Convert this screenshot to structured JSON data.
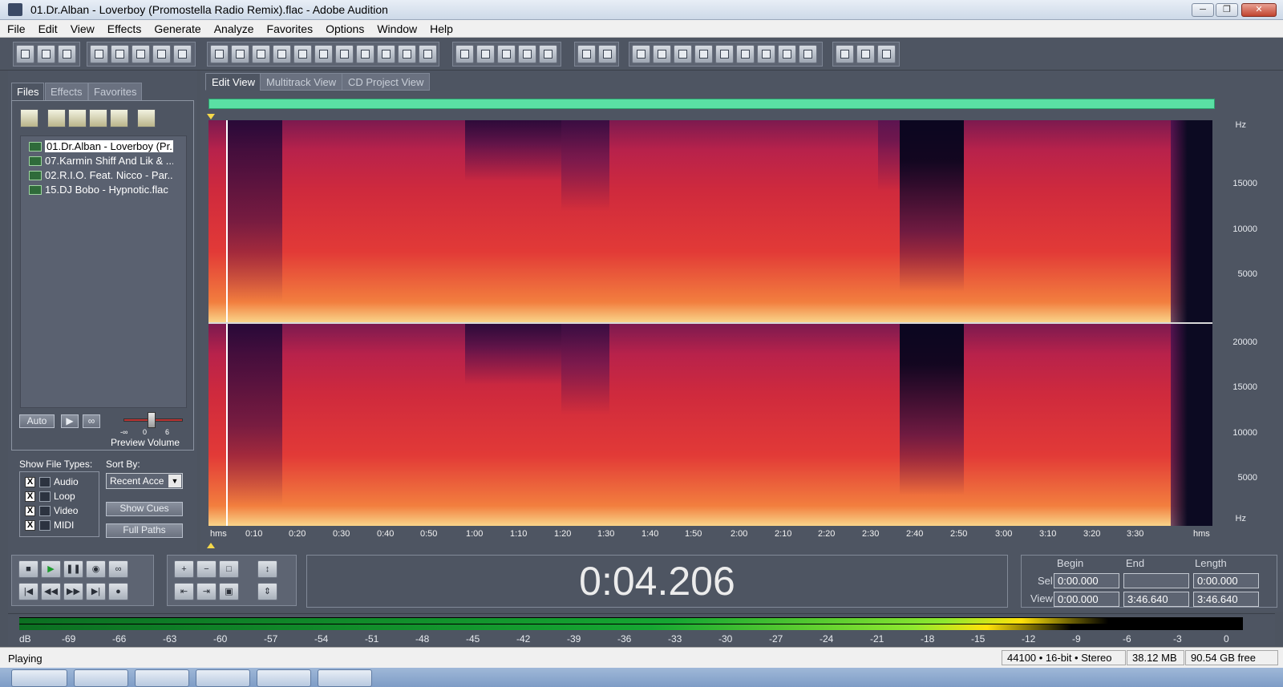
{
  "window": {
    "title": "01.Dr.Alban - Loverboy (Promostella Radio Remix).flac - Adobe Audition"
  },
  "menu": [
    "File",
    "Edit",
    "View",
    "Effects",
    "Generate",
    "Analyze",
    "Favorites",
    "Options",
    "Window",
    "Help"
  ],
  "panel": {
    "tabs": [
      "Files",
      "Effects",
      "Favorites"
    ],
    "files": [
      "01.Dr.Alban - Loverboy (Pr...",
      "07.Karmin Shiff And Lik & ...",
      "02.R.I.O. Feat. Nicco - Par...",
      "15.DJ Bobo - Hypnotic.flac"
    ],
    "auto_label": "Auto",
    "preview_volume_label": "Preview Volume",
    "slider_ticks": [
      "-∞",
      "0",
      "6"
    ],
    "show_file_types_label": "Show File Types:",
    "sort_by_label": "Sort By:",
    "file_types": [
      {
        "label": "Audio",
        "checked": "X"
      },
      {
        "label": "Loop",
        "checked": "X"
      },
      {
        "label": "Video",
        "checked": "X"
      },
      {
        "label": "MIDI",
        "checked": "X"
      }
    ],
    "sort_value": "Recent Acce",
    "show_cues_label": "Show Cues",
    "full_paths_label": "Full Paths"
  },
  "views": {
    "tabs": [
      "Edit View",
      "Multitrack View",
      "CD Project View"
    ]
  },
  "spectrogram": {
    "hz_unit": "Hz",
    "top_channel_ticks": [
      "15000",
      "10000",
      "5000"
    ],
    "bottom_channel_ticks": [
      "20000",
      "15000",
      "10000",
      "5000"
    ],
    "time_unit": "hms",
    "time_ticks": [
      "0:10",
      "0:20",
      "0:30",
      "0:40",
      "0:50",
      "1:00",
      "1:10",
      "1:20",
      "1:30",
      "1:40",
      "1:50",
      "2:00",
      "2:10",
      "2:20",
      "2:30",
      "2:40",
      "2:50",
      "3:00",
      "3:10",
      "3:20",
      "3:30"
    ]
  },
  "transport": {
    "time": "0:04.206"
  },
  "selection": {
    "headers": [
      "Begin",
      "End",
      "Length"
    ],
    "sel_label": "Sel",
    "view_label": "View",
    "sel": {
      "begin": "0:00.000",
      "end": "",
      "length": "0:00.000"
    },
    "view": {
      "begin": "0:00.000",
      "end": "3:46.640",
      "length": "3:46.640"
    }
  },
  "meter": {
    "scale": [
      "dB",
      "-69",
      "-66",
      "-63",
      "-60",
      "-57",
      "-54",
      "-51",
      "-48",
      "-45",
      "-42",
      "-39",
      "-36",
      "-33",
      "-30",
      "-27",
      "-24",
      "-21",
      "-18",
      "-15",
      "-12",
      "-9",
      "-6",
      "-3",
      "0"
    ],
    "level_left": 0.89,
    "level_right": 0.86
  },
  "status": {
    "state": "Playing",
    "format": "44100 • 16-bit • Stereo",
    "size": "38.12 MB",
    "free": "90.54 GB free"
  }
}
